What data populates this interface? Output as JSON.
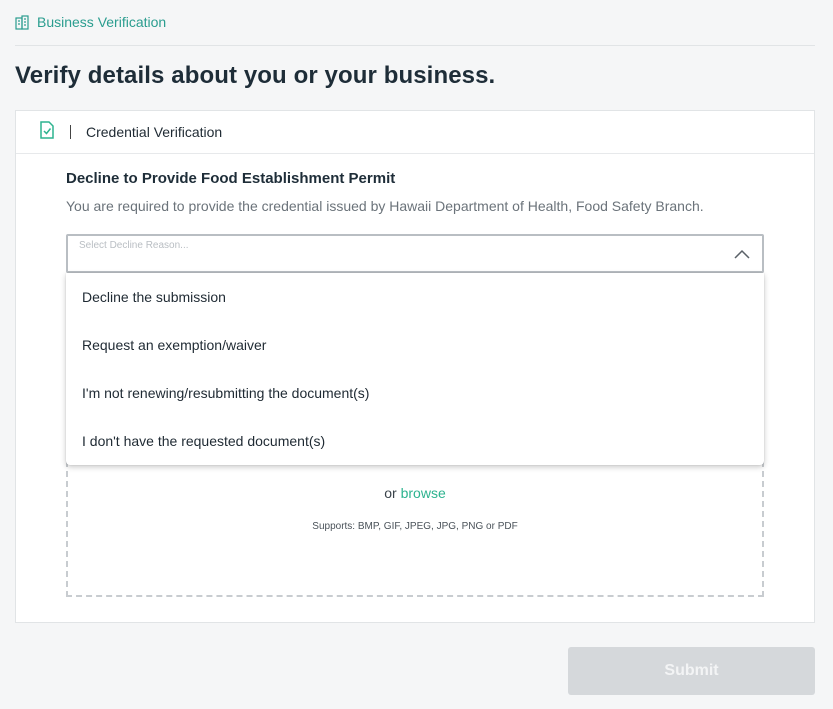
{
  "breadcrumb": {
    "label": "Business Verification",
    "icon": "building-icon"
  },
  "page": {
    "title": "Verify details about you or your business."
  },
  "card": {
    "header_icon": "document-check-icon",
    "header_title": "Credential Verification",
    "section_title": "Decline to Provide Food Establishment Permit",
    "section_desc": "You are required to provide the credential issued by Hawaii Department of Health, Food Safety Branch."
  },
  "select": {
    "placeholder": "Select Decline Reason...",
    "state": "open",
    "options": [
      "Decline the submission",
      "Request an exemption/waiver",
      "I'm not renewing/resubmitting the document(s)",
      "I don't have the requested document(s)"
    ]
  },
  "upload": {
    "or_text": "or",
    "browse_label": "browse",
    "supports": "Supports: BMP, GIF, JPEG, JPG, PNG or PDF"
  },
  "submit": {
    "label": "Submit",
    "enabled": false
  },
  "colors": {
    "accent": "#2a9d8f",
    "link": "#2db38f",
    "disabled_button": "#d5d8db"
  }
}
